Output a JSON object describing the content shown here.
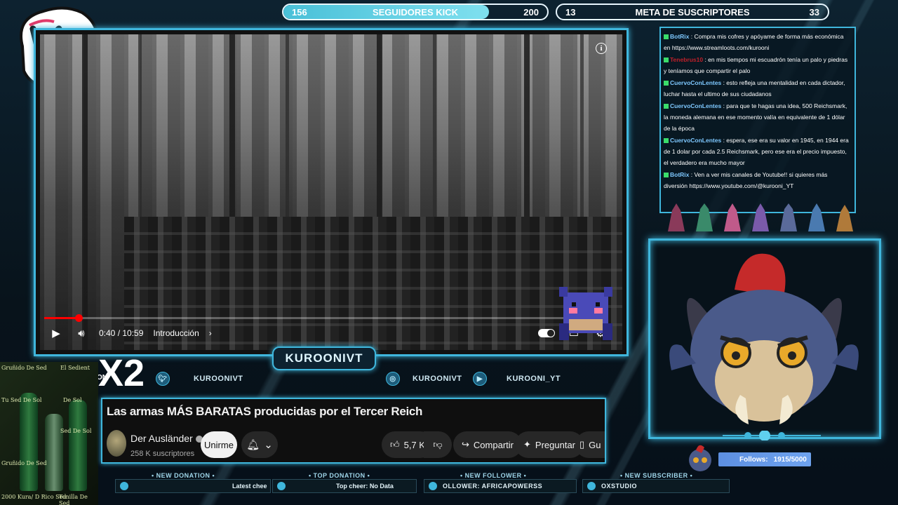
{
  "top_bars": {
    "kick": {
      "label": "SEGUIDORES KICK",
      "current": "156",
      "goal": "200",
      "progress": 0.78
    },
    "subs": {
      "label": "META DE SUSCRIPTORES",
      "current": "13",
      "goal": "33",
      "progress": 0
    }
  },
  "video": {
    "time": "0:40 / 10:59",
    "chapter": "Introducción",
    "progress": 0.061,
    "info_icon": "i"
  },
  "nameplate": "KUROONIVT",
  "overlay_x2": "X2",
  "on_label": "ON",
  "socials": [
    {
      "icon": "twitter-icon",
      "label": "KUROONIVT"
    },
    {
      "icon": "instagram-icon",
      "label": "KUROONIVT"
    },
    {
      "icon": "youtube-icon",
      "label": "KUROONI_YT"
    }
  ],
  "video_info": {
    "title": "Las armas MÁS BARATAS producidas por el Tercer Reich",
    "channel": "Der Ausländer",
    "subscribers": "258 K suscriptores",
    "subscribe": "Unirme",
    "likes": "5,7 K",
    "share": "Compartir",
    "ask": "Preguntar",
    "save_cut": "Gu"
  },
  "left_cam_text": [
    "Gruñido De Sed",
    "El Sedient",
    "Tu Sed De Sol",
    "De Sol",
    "Sed De Sol",
    "Gruñido De Sed",
    "2000 Kura/ D Rico Sed",
    "Tonilla De Sed"
  ],
  "bottom": {
    "donation": {
      "label": "NEW DONATION",
      "value": "Latest chee"
    },
    "top_donation": {
      "label": "TOP DONATION",
      "value": "Top cheer: No Data"
    },
    "follower": {
      "label": "NEW FOLLOWER",
      "value": "OLLOWER: AFRICAPOWERSS"
    },
    "subscriber": {
      "label": "NEW SUBSCRIBER",
      "value": "OXSTUDIO"
    }
  },
  "chat": [
    {
      "user": "BotRix",
      "color": "#7ec8ff",
      "text": ": Compra mis cofres y apóyame de forma más económica en https://www.streamloots.com/kurooni"
    },
    {
      "user": "Tenebrus10",
      "color": "#c0202a",
      "text": ": en mis tiempos mi escuadrón tenía un palo y piedras y teníamos que compartir el palo"
    },
    {
      "user": "CuervoConLentes",
      "color": "#7ec8ff",
      "text": ": esto refleja una mentalidad en cada dictador, luchar hasta el ultimo de sus ciudadanos"
    },
    {
      "user": "CuervoConLentes",
      "color": "#7ec8ff",
      "text": ": para que te hagas una idea, 500 Reichsmark, la moneda alemana en ese momento valía en equivalente de 1 dólar de la época"
    },
    {
      "user": "CuervoConLentes",
      "color": "#7ec8ff",
      "text": ": espera, ese era su valor en 1945, en 1944 era de 1 dolar por cada 2.5 Reichsmark, pero ese era el precio impuesto, el verdadero era mucho mayor"
    },
    {
      "user": "BotRix",
      "color": "#7ec8ff",
      "text": ": Ven a ver mis canales de Youtube!! si quieres más diversión https://www.youtube.com/@kurooni_YT"
    }
  ],
  "follows": {
    "label": "Follows:",
    "value": "1915/5000"
  },
  "colors": {
    "accent": "#3fb6dc",
    "kick_fill": "#5ecfe3",
    "follows_bar": "#6ea3ef"
  }
}
